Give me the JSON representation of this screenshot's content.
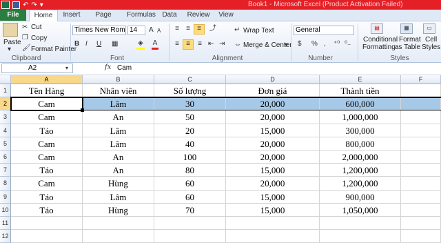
{
  "window": {
    "title": "Book1 - Microsoft Excel (Product Activation Failed)"
  },
  "tabs": [
    "File",
    "Home",
    "Insert",
    "Page Layout",
    "Formulas",
    "Data",
    "Review",
    "View"
  ],
  "ribbon": {
    "clipboard": {
      "paste": "Paste",
      "cut": "Cut",
      "copy": "Copy",
      "format_painter": "Format Painter",
      "label": "Clipboard"
    },
    "font": {
      "name": "Times New Roman",
      "size": "14",
      "bold": "B",
      "italic": "I",
      "underline": "U",
      "label": "Font"
    },
    "alignment": {
      "wrap_text": "Wrap Text",
      "merge_center": "Merge & Center",
      "label": "Alignment"
    },
    "number": {
      "format": "General",
      "currency": "$",
      "percent": "%",
      "comma": ",",
      "label": "Number"
    },
    "styles": {
      "conditional": "Conditional",
      "formatting": "Formatting",
      "format_as": "Format",
      "as_table": "as Table",
      "cell": "Cell",
      "cell_styles": "Styles",
      "label": "Styles"
    }
  },
  "formula_bar": {
    "name_box": "A2",
    "fx": "fx",
    "value": "Cam"
  },
  "grid": {
    "columns": [
      "A",
      "B",
      "C",
      "D",
      "E",
      "F"
    ],
    "rows": [
      {
        "num": "1",
        "cells": [
          "Tên Hàng",
          "Nhân viên",
          "Số lượng",
          "Đơn giá",
          "Thành tiền",
          ""
        ]
      },
      {
        "num": "2",
        "cells": [
          "Cam",
          "Lâm",
          "30",
          "20,000",
          "600,000",
          ""
        ]
      },
      {
        "num": "3",
        "cells": [
          "Cam",
          "An",
          "50",
          "20,000",
          "1,000,000",
          ""
        ]
      },
      {
        "num": "4",
        "cells": [
          "Táo",
          "Lâm",
          "20",
          "15,000",
          "300,000",
          ""
        ]
      },
      {
        "num": "5",
        "cells": [
          "Cam",
          "Lâm",
          "40",
          "20,000",
          "800,000",
          ""
        ]
      },
      {
        "num": "6",
        "cells": [
          "Cam",
          "An",
          "100",
          "20,000",
          "2,000,000",
          ""
        ]
      },
      {
        "num": "7",
        "cells": [
          "Táo",
          "An",
          "80",
          "15,000",
          "1,200,000",
          ""
        ]
      },
      {
        "num": "8",
        "cells": [
          "Cam",
          "Hùng",
          "60",
          "20,000",
          "1,200,000",
          ""
        ]
      },
      {
        "num": "9",
        "cells": [
          "Táo",
          "Lâm",
          "60",
          "15,000",
          "900,000",
          ""
        ]
      },
      {
        "num": "10",
        "cells": [
          "Táo",
          "Hùng",
          "70",
          "15,000",
          "1,050,000",
          ""
        ]
      },
      {
        "num": "11",
        "cells": [
          "",
          "",
          "",
          "",
          "",
          ""
        ]
      },
      {
        "num": "12",
        "cells": [
          "",
          "",
          "",
          "",
          "",
          ""
        ]
      }
    ],
    "active_cell": "A2",
    "highlight_color": "#a7c9e8"
  }
}
